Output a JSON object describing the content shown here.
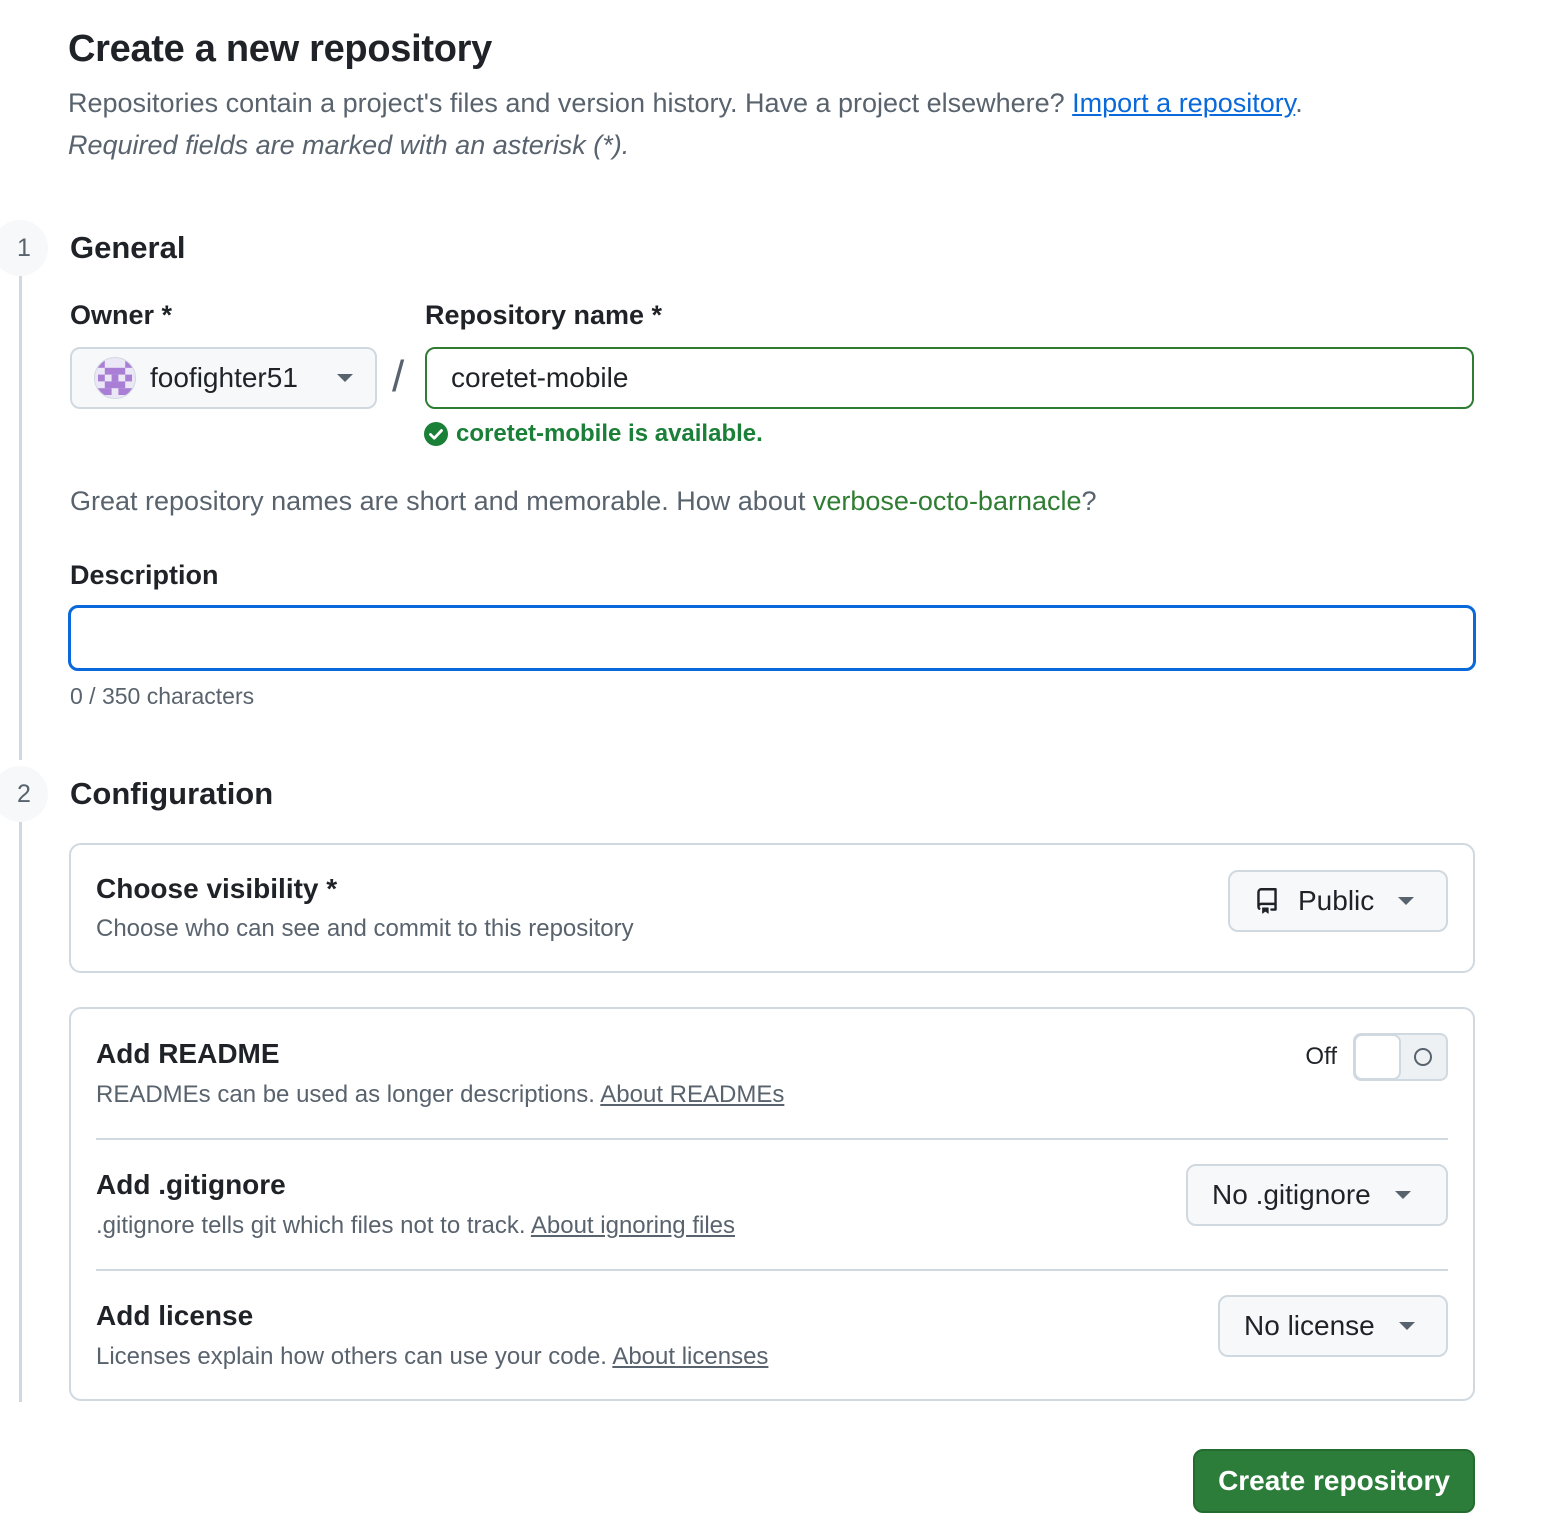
{
  "header": {
    "title": "Create a new repository",
    "intro_text": "Repositories contain a project's files and version history. Have a project elsewhere? ",
    "import_link": "Import a repository",
    "intro_end": ".",
    "required_note": "Required fields are marked with an asterisk (*)."
  },
  "sections": [
    {
      "number": "1",
      "title": "General"
    },
    {
      "number": "2",
      "title": "Configuration"
    }
  ],
  "general": {
    "owner_label": "Owner *",
    "owner_value": "foofighter51",
    "slash": "/",
    "repo_label": "Repository name *",
    "repo_value": "coretet-mobile",
    "availability": "coretet-mobile is available.",
    "suggest_prefix": "Great repository names are short and memorable. How about ",
    "suggest_name": "verbose-octo-barnacle",
    "suggest_suffix": "?",
    "description_label": "Description",
    "description_value": "",
    "char_count": "0 / 350 characters"
  },
  "configuration": {
    "visibility": {
      "title": "Choose visibility *",
      "subtitle": "Choose who can see and commit to this repository",
      "value": "Public"
    },
    "readme": {
      "title": "Add README",
      "subtitle": "READMEs can be used as longer descriptions. ",
      "link": "About READMEs",
      "toggle_state": "Off"
    },
    "gitignore": {
      "title": "Add .gitignore",
      "subtitle": ".gitignore tells git which files not to track. ",
      "link": "About ignoring files",
      "value": "No .gitignore"
    },
    "license": {
      "title": "Add license",
      "subtitle": "Licenses explain how others can use your code. ",
      "link": "About licenses",
      "value": "No license"
    }
  },
  "footer": {
    "create_button": "Create repository"
  },
  "colors": {
    "accent_link": "#0969da",
    "success": "#1a7f37",
    "primary_button": "#2c7d3a",
    "focus_border": "#0969da"
  },
  "icons": {
    "owner_avatar": "identicon-avatar",
    "availability": "check-circle-icon",
    "visibility": "repo-icon",
    "dropdown": "triangle-down-icon"
  }
}
